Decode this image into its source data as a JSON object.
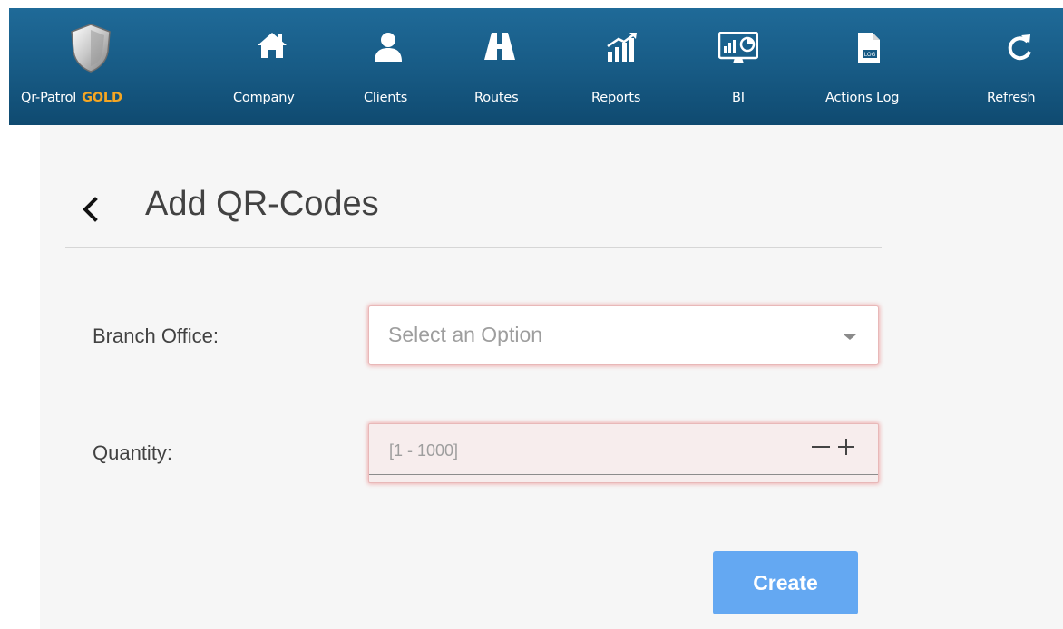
{
  "nav": {
    "brand": {
      "name": "Qr-Patrol",
      "tier": "GOLD",
      "icon": "shield-icon"
    },
    "items": [
      {
        "label": "Company",
        "icon": "home-icon"
      },
      {
        "label": "Clients",
        "icon": "user-icon"
      },
      {
        "label": "Routes",
        "icon": "road-icon"
      },
      {
        "label": "Reports",
        "icon": "bar-chart-icon"
      },
      {
        "label": "BI",
        "icon": "dashboard-icon"
      },
      {
        "label": "Actions Log",
        "icon": "log-file-icon"
      },
      {
        "label": "Refresh",
        "icon": "refresh-icon"
      }
    ]
  },
  "page": {
    "title": "Add QR-Codes"
  },
  "form": {
    "branch_label": "Branch Office:",
    "branch_placeholder": "Select an Option",
    "quantity_label": "Quantity:",
    "quantity_placeholder": "[1 - 1000]",
    "create_label": "Create"
  },
  "colors": {
    "nav_bg": "#175a84",
    "gold": "#f5a623",
    "error_glow": "#e85a5a",
    "primary_button": "#64a8f2"
  }
}
